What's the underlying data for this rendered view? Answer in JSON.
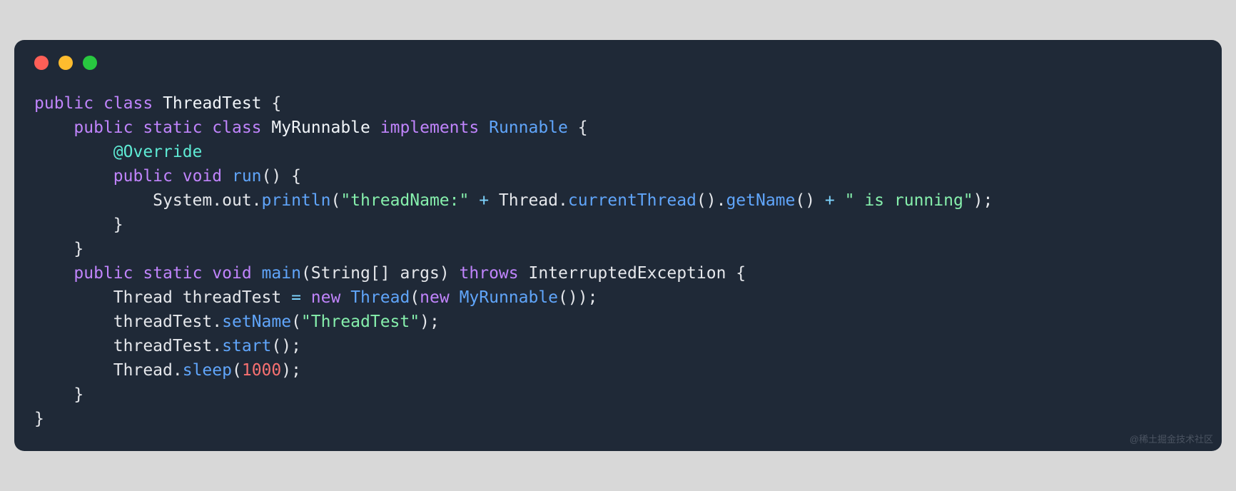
{
  "colors": {
    "background": "#1f2937",
    "traffic_red": "#ff5f57",
    "traffic_yellow": "#febc2e",
    "traffic_green": "#28c840",
    "keyword": "#c084fc",
    "function": "#60a5fa",
    "string": "#86efac",
    "annotation": "#5eead4",
    "number": "#f87171",
    "operator": "#7dd3fc",
    "text": "#e5e7eb"
  },
  "watermark": "@稀土掘金技术社区",
  "code": {
    "language": "java",
    "tokens": [
      [
        {
          "t": "public",
          "c": "kw"
        },
        {
          "t": " ",
          "c": "pn"
        },
        {
          "t": "class",
          "c": "kw"
        },
        {
          "t": " ",
          "c": "pn"
        },
        {
          "t": "ThreadTest",
          "c": "type"
        },
        {
          "t": " {",
          "c": "pn"
        }
      ],
      [
        {
          "t": "    ",
          "c": "pn"
        },
        {
          "t": "public",
          "c": "kw"
        },
        {
          "t": " ",
          "c": "pn"
        },
        {
          "t": "static",
          "c": "kw"
        },
        {
          "t": " ",
          "c": "pn"
        },
        {
          "t": "class",
          "c": "kw"
        },
        {
          "t": " ",
          "c": "pn"
        },
        {
          "t": "MyRunnable",
          "c": "type"
        },
        {
          "t": " ",
          "c": "pn"
        },
        {
          "t": "implements",
          "c": "kw"
        },
        {
          "t": " ",
          "c": "pn"
        },
        {
          "t": "Runnable",
          "c": "fn"
        },
        {
          "t": " {",
          "c": "pn"
        }
      ],
      [
        {
          "t": "        ",
          "c": "pn"
        },
        {
          "t": "@Override",
          "c": "ann"
        }
      ],
      [
        {
          "t": "        ",
          "c": "pn"
        },
        {
          "t": "public",
          "c": "kw"
        },
        {
          "t": " ",
          "c": "pn"
        },
        {
          "t": "void",
          "c": "kw"
        },
        {
          "t": " ",
          "c": "pn"
        },
        {
          "t": "run",
          "c": "fn"
        },
        {
          "t": "() {",
          "c": "pn"
        }
      ],
      [
        {
          "t": "            ",
          "c": "pn"
        },
        {
          "t": "System",
          "c": "id"
        },
        {
          "t": ".",
          "c": "pn"
        },
        {
          "t": "out",
          "c": "id"
        },
        {
          "t": ".",
          "c": "pn"
        },
        {
          "t": "println",
          "c": "call"
        },
        {
          "t": "(",
          "c": "pn"
        },
        {
          "t": "\"threadName:\"",
          "c": "str"
        },
        {
          "t": " ",
          "c": "pn"
        },
        {
          "t": "+",
          "c": "op"
        },
        {
          "t": " ",
          "c": "pn"
        },
        {
          "t": "Thread",
          "c": "id"
        },
        {
          "t": ".",
          "c": "pn"
        },
        {
          "t": "currentThread",
          "c": "call"
        },
        {
          "t": "().",
          "c": "pn"
        },
        {
          "t": "getName",
          "c": "call"
        },
        {
          "t": "() ",
          "c": "pn"
        },
        {
          "t": "+",
          "c": "op"
        },
        {
          "t": " ",
          "c": "pn"
        },
        {
          "t": "\" is running\"",
          "c": "str"
        },
        {
          "t": ");",
          "c": "pn"
        }
      ],
      [
        {
          "t": "        }",
          "c": "pn"
        }
      ],
      [
        {
          "t": "    }",
          "c": "pn"
        }
      ],
      [
        {
          "t": "    ",
          "c": "pn"
        },
        {
          "t": "public",
          "c": "kw"
        },
        {
          "t": " ",
          "c": "pn"
        },
        {
          "t": "static",
          "c": "kw"
        },
        {
          "t": " ",
          "c": "pn"
        },
        {
          "t": "void",
          "c": "kw"
        },
        {
          "t": " ",
          "c": "pn"
        },
        {
          "t": "main",
          "c": "fn"
        },
        {
          "t": "(",
          "c": "pn"
        },
        {
          "t": "String",
          "c": "id"
        },
        {
          "t": "[] ",
          "c": "pn"
        },
        {
          "t": "args",
          "c": "id"
        },
        {
          "t": ") ",
          "c": "pn"
        },
        {
          "t": "throws",
          "c": "kw"
        },
        {
          "t": " ",
          "c": "pn"
        },
        {
          "t": "InterruptedException",
          "c": "id"
        },
        {
          "t": " {",
          "c": "pn"
        }
      ],
      [
        {
          "t": "        ",
          "c": "pn"
        },
        {
          "t": "Thread",
          "c": "id"
        },
        {
          "t": " ",
          "c": "pn"
        },
        {
          "t": "threadTest",
          "c": "id"
        },
        {
          "t": " ",
          "c": "pn"
        },
        {
          "t": "=",
          "c": "op"
        },
        {
          "t": " ",
          "c": "pn"
        },
        {
          "t": "new",
          "c": "kw"
        },
        {
          "t": " ",
          "c": "pn"
        },
        {
          "t": "Thread",
          "c": "call"
        },
        {
          "t": "(",
          "c": "pn"
        },
        {
          "t": "new",
          "c": "kw"
        },
        {
          "t": " ",
          "c": "pn"
        },
        {
          "t": "MyRunnable",
          "c": "call"
        },
        {
          "t": "());",
          "c": "pn"
        }
      ],
      [
        {
          "t": "        ",
          "c": "pn"
        },
        {
          "t": "threadTest",
          "c": "id"
        },
        {
          "t": ".",
          "c": "pn"
        },
        {
          "t": "setName",
          "c": "call"
        },
        {
          "t": "(",
          "c": "pn"
        },
        {
          "t": "\"ThreadTest\"",
          "c": "str"
        },
        {
          "t": ");",
          "c": "pn"
        }
      ],
      [
        {
          "t": "        ",
          "c": "pn"
        },
        {
          "t": "threadTest",
          "c": "id"
        },
        {
          "t": ".",
          "c": "pn"
        },
        {
          "t": "start",
          "c": "call"
        },
        {
          "t": "();",
          "c": "pn"
        }
      ],
      [
        {
          "t": "        ",
          "c": "pn"
        },
        {
          "t": "Thread",
          "c": "id"
        },
        {
          "t": ".",
          "c": "pn"
        },
        {
          "t": "sleep",
          "c": "call"
        },
        {
          "t": "(",
          "c": "pn"
        },
        {
          "t": "1000",
          "c": "num"
        },
        {
          "t": ");",
          "c": "pn"
        }
      ],
      [
        {
          "t": "    }",
          "c": "pn"
        }
      ],
      [
        {
          "t": "}",
          "c": "pn"
        }
      ]
    ]
  }
}
